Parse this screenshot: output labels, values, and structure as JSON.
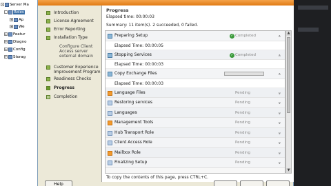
{
  "tree": {
    "items": [
      {
        "expander": "-",
        "label": "Server Ma",
        "selected": false
      },
      {
        "expander": "-",
        "label": "Roles",
        "selected": true
      },
      {
        "expander": "+",
        "label": "Ap",
        "selected": false
      },
      {
        "expander": "+",
        "label": "We",
        "selected": false
      },
      {
        "expander": "+",
        "label": "Featur",
        "selected": false
      },
      {
        "expander": "+",
        "label": "Diagno",
        "selected": false
      },
      {
        "expander": "+",
        "label": "Config",
        "selected": false
      },
      {
        "expander": "+",
        "label": "Storag",
        "selected": false
      }
    ]
  },
  "steps": [
    {
      "label": "Introduction",
      "state": "done"
    },
    {
      "label": "License Agreement",
      "state": "done"
    },
    {
      "label": "Error Reporting",
      "state": "done"
    },
    {
      "label": "Installation Type",
      "state": "done"
    },
    {
      "label": "Configure Client Access server external domain",
      "state": "sub"
    },
    {
      "label": "Customer Experience Improvement Program",
      "state": "done"
    },
    {
      "label": "Readiness Checks",
      "state": "done"
    },
    {
      "label": "Progress",
      "state": "current"
    },
    {
      "label": "Completion",
      "state": "pending"
    }
  ],
  "progress": {
    "title": "Progress",
    "elapsed": "Elapsed time: 00:00:03",
    "summary": "Summary: 11 item(s). 2 succeeded, 0 failed.",
    "copy_hint": "To copy the contents of this page, press CTRL+C."
  },
  "tasks": [
    {
      "name": "Preparing Setup",
      "status": "Completed",
      "icon": "setup-icon",
      "kind": "completed",
      "detail": "Elapsed Time: 00:00:05"
    },
    {
      "name": "Stopping Services",
      "status": "Completed",
      "icon": "services-icon",
      "kind": "completed",
      "detail": "Elapsed Time: 00:00:03"
    },
    {
      "name": "Copy Exchange Files",
      "status": "",
      "icon": "copy-files-icon",
      "kind": "running",
      "progress": 0.0,
      "detail": "Elapsed Time: 00:00:03"
    },
    {
      "name": "Language Files",
      "status": "Pending",
      "icon": "language-files-icon",
      "kind": "pending"
    },
    {
      "name": "Restoring services",
      "status": "Pending",
      "icon": "restore-services-icon",
      "kind": "pending"
    },
    {
      "name": "Languages",
      "status": "Pending",
      "icon": "languages-icon",
      "kind": "pending"
    },
    {
      "name": "Management Tools",
      "status": "Pending",
      "icon": "management-tools-icon",
      "kind": "pending"
    },
    {
      "name": "Hub Transport Role",
      "status": "Pending",
      "icon": "hub-transport-icon",
      "kind": "pending"
    },
    {
      "name": "Client Access Role",
      "status": "Pending",
      "icon": "client-access-icon",
      "kind": "pending"
    },
    {
      "name": "Mailbox Role",
      "status": "Pending",
      "icon": "mailbox-icon",
      "kind": "pending"
    },
    {
      "name": "Finalizing Setup",
      "status": "Pending",
      "icon": "finalizing-icon",
      "kind": "pending"
    }
  ],
  "buttons": {
    "help": "Help"
  },
  "colors": {
    "accent_orange": "#e07b14",
    "step_green": "#8cb24a",
    "completed_check": "#3b9a3b"
  }
}
